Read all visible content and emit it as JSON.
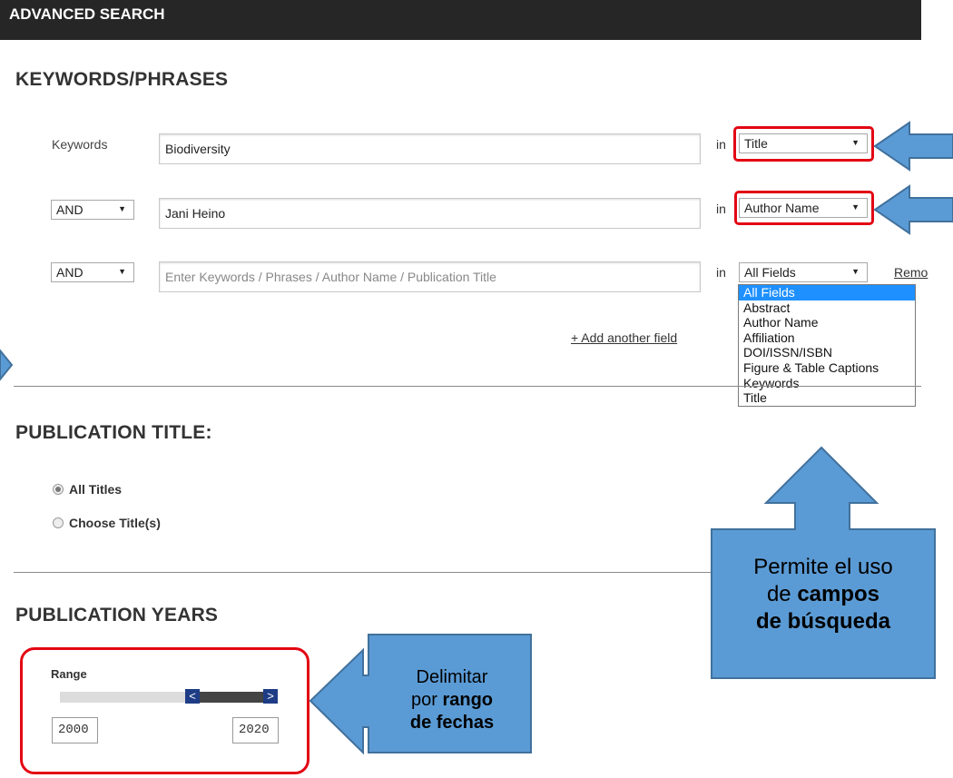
{
  "header": {
    "title": "ADVANCED SEARCH"
  },
  "keywords_section": {
    "heading": "KEYWORDS/PHRASES",
    "rows": [
      {
        "operator_label": "Keywords",
        "value": "Biodiversity",
        "in_label": "in",
        "field": "Title"
      },
      {
        "operator": "AND",
        "value": "Jani Heino",
        "in_label": "in",
        "field": "Author Name"
      },
      {
        "operator": "AND",
        "value": "",
        "placeholder": "Enter Keywords / Phrases / Author Name / Publication Title",
        "in_label": "in",
        "field": "All Fields",
        "remove_label": "Remo"
      }
    ],
    "add_field_link": "+ Add another field",
    "field_options": [
      "All Fields",
      "Abstract",
      "Author Name",
      "Affiliation",
      "DOI/ISSN/ISBN",
      "Figure & Table Captions",
      "Keywords",
      "Title"
    ],
    "selected_option": "All Fields"
  },
  "publication_title_section": {
    "heading": "PUBLICATION TITLE:",
    "options": [
      {
        "label": "All Titles",
        "checked": true
      },
      {
        "label": "Choose Title(s)",
        "checked": false
      }
    ]
  },
  "publication_years_section": {
    "heading": "PUBLICATION YEARS",
    "range_label": "Range",
    "from_year": "2000",
    "to_year": "2020",
    "slider_left_glyph": "<",
    "slider_right_glyph": ">"
  },
  "annotations": {
    "fields_callout": {
      "line1": "Permite el uso",
      "line2_prefix": "de ",
      "line2_bold": "campos",
      "line3_bold": "de búsqueda"
    },
    "dates_callout": {
      "line1": "Delimitar",
      "line2_prefix": "por  ",
      "line2_bold": "rango",
      "line3_bold": "de fechas"
    }
  },
  "colors": {
    "header_bg": "#262626",
    "callout_fill": "#5b9bd5",
    "callout_stroke": "#41719c",
    "highlight_ring": "#e30613",
    "selected_option": "#1e90ff",
    "slider_handle": "#1e3d86"
  }
}
